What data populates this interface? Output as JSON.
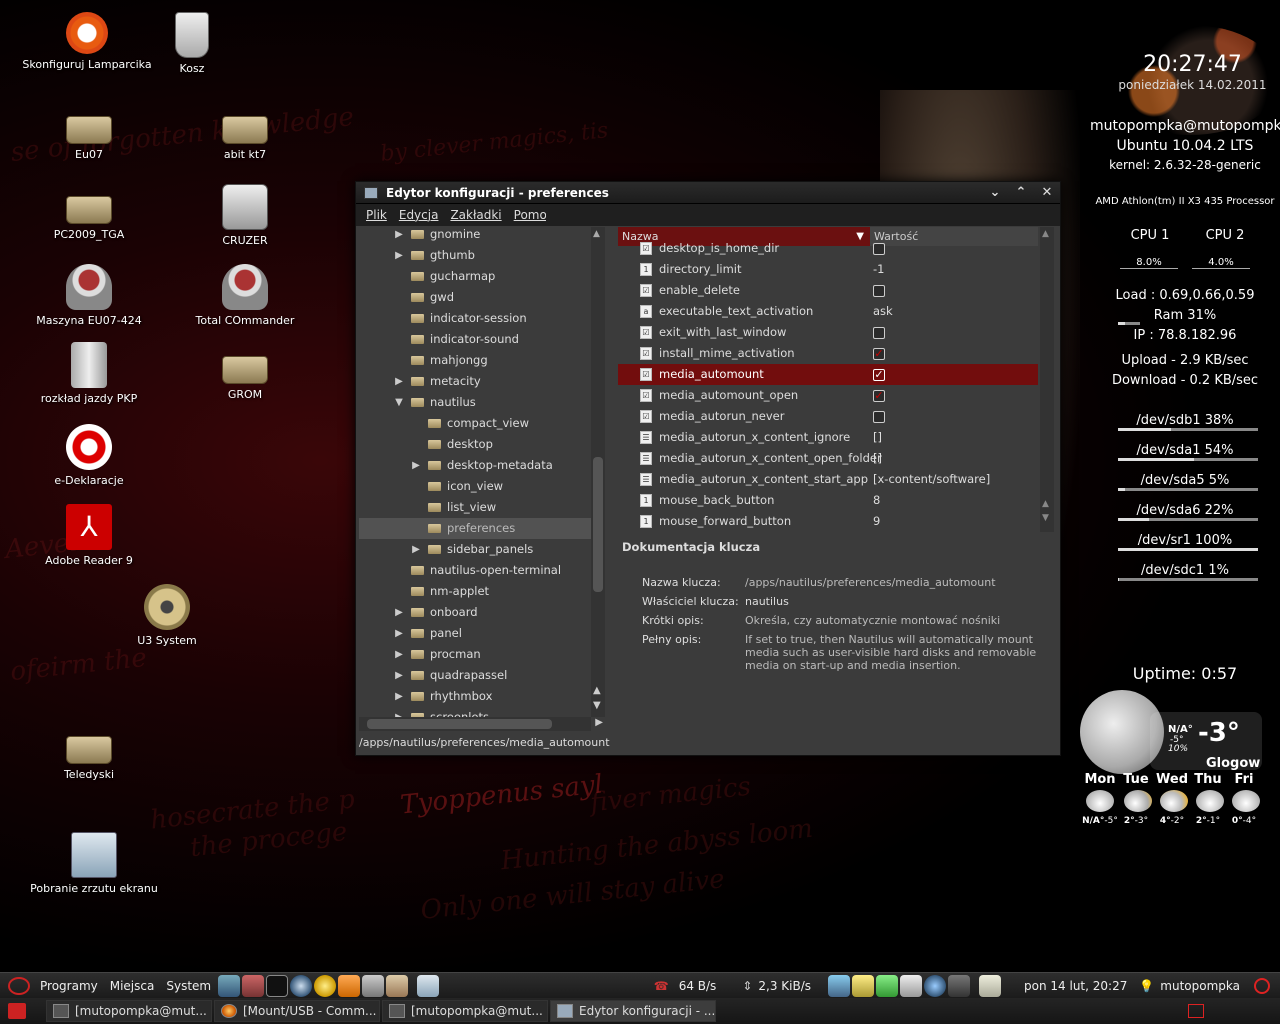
{
  "desktop": {
    "wallpaper_text": [
      "se of forgotten knowledge",
      "by clever magics, tis",
      "Aevelio",
      "Tyoppenus sayl",
      "fiver magics",
      "Hunting the abyss loom",
      "Only one will stay alive",
      "the procege",
      "hosecrate the p",
      "ofeirm the"
    ],
    "icons": [
      {
        "label": "Skonfiguruj Lamparcika",
        "icon": "ubuntu-logo-icon"
      },
      {
        "label": "Kosz",
        "icon": "trash-icon"
      },
      {
        "label": "Eu07",
        "icon": "drive-icon"
      },
      {
        "label": "abit kt7",
        "icon": "drive-icon"
      },
      {
        "label": "PC2009_TGA",
        "icon": "drive-icon"
      },
      {
        "label": "CRUZER",
        "icon": "usb-drive-icon"
      },
      {
        "label": "Maszyna EU07-424",
        "icon": "wine-cup-icon"
      },
      {
        "label": "Total COmmander",
        "icon": "wine-cup-icon"
      },
      {
        "label": "rozkład jazdy PKP",
        "icon": "pillar-icon"
      },
      {
        "label": "GROM",
        "icon": "drive-icon"
      },
      {
        "label": "e-Deklaracje",
        "icon": "e-deklaracje-icon"
      },
      {
        "label": "Adobe Reader 9",
        "icon": "adobe-reader-icon"
      },
      {
        "label": "U3 System",
        "icon": "disc-icon"
      },
      {
        "label": "Teledyski",
        "icon": "drive-icon"
      },
      {
        "label": "Pobranie zrzutu ekranu",
        "icon": "screenshot-icon"
      }
    ]
  },
  "conky": {
    "time": "20:27:47",
    "date": "poniedziałek 14.02.2011",
    "user": "mutopompka@mutopompka",
    "os": "Ubuntu 10.04.2 LTS",
    "kernel": "kernel: 2.6.32-28-generic",
    "cpu_name": "AMD Athlon(tm) II X3 435 Processor",
    "cpu1_label": "CPU 1",
    "cpu2_label": "CPU 2",
    "cpu1_value": "8.0%",
    "cpu2_value": "4.0%",
    "load": "Load : 0.69,0.66,0.59",
    "ram": "Ram 31%",
    "ram_level": 0.31,
    "ip": "IP : 78.8.182.96",
    "upload": "Upload - 2.9 KB/sec",
    "download": "Download - 0.2 KB/sec",
    "disks": [
      {
        "label": "/dev/sdb1 38%",
        "level": 0.38
      },
      {
        "label": "/dev/sda1 54%",
        "level": 0.54
      },
      {
        "label": "/dev/sda5 5%",
        "level": 0.05
      },
      {
        "label": "/dev/sda6 22%",
        "level": 0.22
      },
      {
        "label": "/dev/sr1 100%",
        "level": 1.0
      },
      {
        "label": "/dev/sdc1 1%",
        "level": 0.01
      }
    ],
    "uptime": "Uptime: 0:57"
  },
  "weather": {
    "now_na": "N/A°",
    "now_low": "-5°",
    "now_humidity": "10%",
    "temp": "-3°",
    "city": "Glogow",
    "days": [
      {
        "day": "Mon",
        "hi": "N/A°",
        "lo": "-5°"
      },
      {
        "day": "Tue",
        "hi": "2°",
        "lo": "-3°"
      },
      {
        "day": "Wed",
        "hi": "4°",
        "lo": "-2°"
      },
      {
        "day": "Thu",
        "hi": "2°",
        "lo": "-1°"
      },
      {
        "day": "Fri",
        "hi": "0°",
        "lo": "-4°"
      }
    ]
  },
  "window": {
    "title": "Edytor konfiguracji - preferences",
    "menu": [
      "Plik",
      "Edycja",
      "Zakładki",
      "Pomoc"
    ],
    "tree": [
      {
        "label": "gnomine",
        "level": 1,
        "expander": "▶",
        "selected": false
      },
      {
        "label": "gthumb",
        "level": 1,
        "expander": "▶",
        "selected": false
      },
      {
        "label": "gucharmap",
        "level": 1,
        "expander": "",
        "selected": false
      },
      {
        "label": "gwd",
        "level": 1,
        "expander": "",
        "selected": false
      },
      {
        "label": "indicator-session",
        "level": 1,
        "expander": "",
        "selected": false
      },
      {
        "label": "indicator-sound",
        "level": 1,
        "expander": "",
        "selected": false
      },
      {
        "label": "mahjongg",
        "level": 1,
        "expander": "",
        "selected": false
      },
      {
        "label": "metacity",
        "level": 1,
        "expander": "▶",
        "selected": false
      },
      {
        "label": "nautilus",
        "level": 1,
        "expander": "▼",
        "selected": false
      },
      {
        "label": "compact_view",
        "level": 2,
        "expander": "",
        "selected": false
      },
      {
        "label": "desktop",
        "level": 2,
        "expander": "",
        "selected": false
      },
      {
        "label": "desktop-metadata",
        "level": 2,
        "expander": "▶",
        "selected": false
      },
      {
        "label": "icon_view",
        "level": 2,
        "expander": "",
        "selected": false
      },
      {
        "label": "list_view",
        "level": 2,
        "expander": "",
        "selected": false
      },
      {
        "label": "preferences",
        "level": 2,
        "expander": "",
        "selected": true
      },
      {
        "label": "sidebar_panels",
        "level": 2,
        "expander": "▶",
        "selected": false
      },
      {
        "label": "nautilus-open-terminal",
        "level": 1,
        "expander": "",
        "selected": false
      },
      {
        "label": "nm-applet",
        "level": 1,
        "expander": "",
        "selected": false
      },
      {
        "label": "onboard",
        "level": 1,
        "expander": "▶",
        "selected": false
      },
      {
        "label": "panel",
        "level": 1,
        "expander": "▶",
        "selected": false
      },
      {
        "label": "procman",
        "level": 1,
        "expander": "▶",
        "selected": false
      },
      {
        "label": "quadrapassel",
        "level": 1,
        "expander": "▶",
        "selected": false
      },
      {
        "label": "rhythmbox",
        "level": 1,
        "expander": "▶",
        "selected": false
      },
      {
        "label": "screenlets",
        "level": 1,
        "expander": "▶",
        "selected": false
      }
    ],
    "table_headers": {
      "name": "Nazwa",
      "value": "Wartość"
    },
    "keys": [
      {
        "name": "desktop_is_home_dir",
        "type": "bool",
        "value": "",
        "checked": false,
        "selected": false
      },
      {
        "name": "directory_limit",
        "type": "int",
        "value": "-1",
        "checked": false,
        "selected": false
      },
      {
        "name": "enable_delete",
        "type": "bool",
        "value": "",
        "checked": false,
        "selected": false
      },
      {
        "name": "executable_text_activation",
        "type": "string",
        "value": "ask",
        "checked": false,
        "selected": false
      },
      {
        "name": "exit_with_last_window",
        "type": "bool",
        "value": "",
        "checked": false,
        "selected": false
      },
      {
        "name": "install_mime_activation",
        "type": "bool",
        "value": "",
        "checked": true,
        "selected": false
      },
      {
        "name": "media_automount",
        "type": "bool",
        "value": "",
        "checked": true,
        "selected": true
      },
      {
        "name": "media_automount_open",
        "type": "bool",
        "value": "",
        "checked": true,
        "selected": false
      },
      {
        "name": "media_autorun_never",
        "type": "bool",
        "value": "",
        "checked": false,
        "selected": false
      },
      {
        "name": "media_autorun_x_content_ignore",
        "type": "list",
        "value": "[]",
        "checked": false,
        "selected": false
      },
      {
        "name": "media_autorun_x_content_open_folder",
        "type": "list",
        "value": "[]",
        "checked": false,
        "selected": false
      },
      {
        "name": "media_autorun_x_content_start_app",
        "type": "list",
        "value": "[x-content/software]",
        "checked": false,
        "selected": false
      },
      {
        "name": "mouse_back_button",
        "type": "int",
        "value": "8",
        "checked": false,
        "selected": false
      },
      {
        "name": "mouse_forward_button",
        "type": "int",
        "value": "9",
        "checked": false,
        "selected": false
      }
    ],
    "doc": {
      "title": "Dokumentacja klucza",
      "key_name_label": "Nazwa klucza:",
      "key_name": "/apps/nautilus/preferences/media_automount",
      "owner_label": "Właściciel klucza:",
      "owner": "nautilus",
      "short_label": "Krótki opis:",
      "short": "Określa, czy automatycznie montować nośniki",
      "full_label": "Pełny opis:",
      "full": "If set to true, then Nautilus will automatically mount media such as user-visible hard disks and removable media on start-up and media insertion."
    },
    "path": "/apps/nautilus/preferences/media_automount"
  },
  "panel_top": {
    "menu_apps": "Programy",
    "menu_places": "Miejsca",
    "menu_system": "System",
    "net_speed_1": "64 B/s",
    "net_speed_2": "2,3 KiB/s",
    "clock": "pon 14 lut, 20:27",
    "user": "mutopompka"
  },
  "panel_bottom": {
    "tasks": [
      {
        "label": "[mutopompka@mut...",
        "icon": "terminal-icon",
        "active": false
      },
      {
        "label": "[Mount/USB - Comm...",
        "icon": "firefox-icon",
        "active": false
      },
      {
        "label": "[mutopompka@mut...",
        "icon": "terminal-icon",
        "active": false
      },
      {
        "label": "Edytor konfiguracji - ...",
        "icon": "gconf-editor-icon",
        "active": true
      }
    ]
  }
}
